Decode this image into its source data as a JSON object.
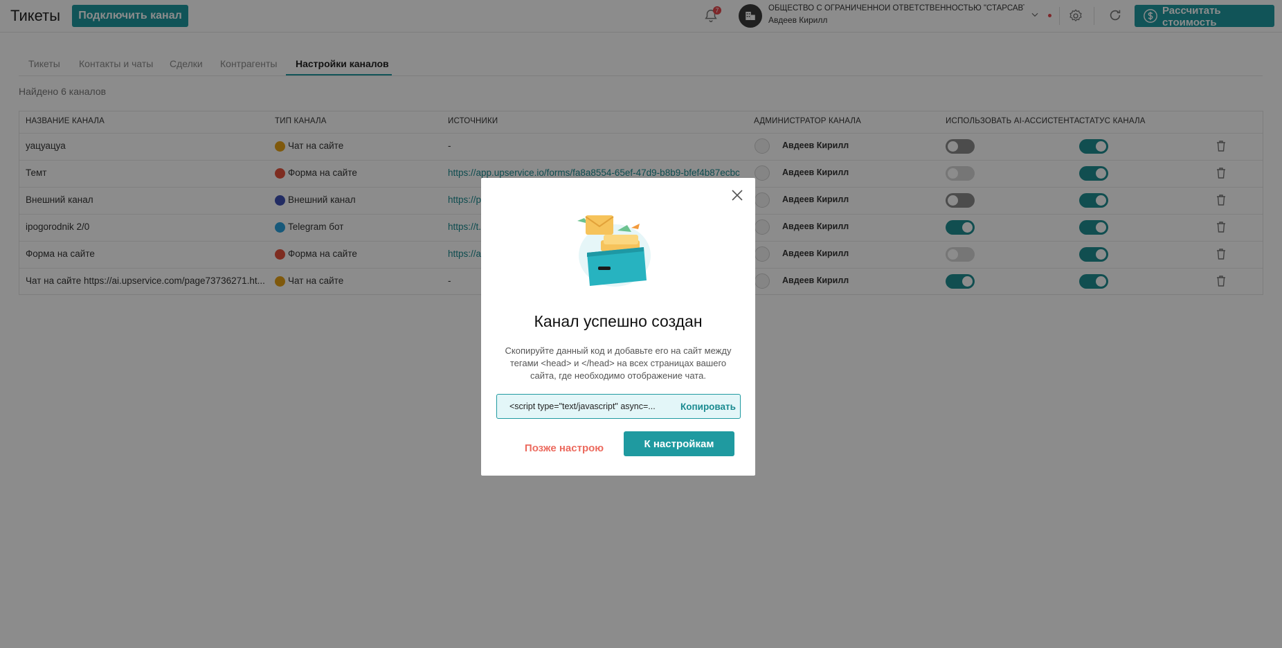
{
  "header": {
    "title": "Тикеты",
    "connect_label": "Подключить канал",
    "notifications_count": "7",
    "org_name": "ОБЩЕСТВО С ОГРАНИЧЕННОЙ ОТВЕТСТВЕННОСТЬЮ \"СТАРСАВТО\"...",
    "user_name": "Авдеев Кирилл",
    "calc_label": "Рассчитать стоимость"
  },
  "tabs": [
    {
      "label": "Тикеты"
    },
    {
      "label": "Контакты и чаты"
    },
    {
      "label": "Сделки"
    },
    {
      "label": "Контрагенты"
    },
    {
      "label": "Настройки каналов",
      "active": true
    }
  ],
  "found_text": "Найдено 6 каналов",
  "table": {
    "columns": [
      "НАЗВАНИЕ КАНАЛА",
      "ТИП КАНАЛА",
      "ИСТОЧНИКИ",
      "АДМИНИСТРАТОР КАНАЛА",
      "ИСПОЛЬЗОВАТЬ AI-АССИСТЕНТА",
      "СТАТУС КАНАЛА"
    ],
    "rows": [
      {
        "name": "уацуацуа",
        "type": "Чат на сайте",
        "type_color": "#e8a317",
        "source": "-",
        "admin": "Авдеев Кирилл",
        "ai": "off",
        "status": "on"
      },
      {
        "name": "Темт",
        "type": "Форма на сайте",
        "type_color": "#e5533d",
        "source": "https://app.upservice.io/forms/fa8a8554-65ef-47d9-b8b9-bfef4b87ecbc",
        "admin": "Авдеев Кирилл",
        "ai": "disabled",
        "status": "on"
      },
      {
        "name": "Внешний канал",
        "type": "Внешний канал",
        "type_color": "#3f51b5",
        "source": "https://p",
        "admin": "Авдеев Кирилл",
        "ai": "off",
        "status": "on"
      },
      {
        "name": "ipogorodnik 2/0",
        "type": "Telegram бот",
        "type_color": "#2aa3df",
        "source": "https://t.",
        "admin": "Авдеев Кирилл",
        "ai": "on",
        "status": "on"
      },
      {
        "name": "Форма на сайте",
        "type": "Форма на сайте",
        "type_color": "#e5533d",
        "source": "https://a",
        "admin": "Авдеев Кирилл",
        "ai": "disabled",
        "status": "on"
      },
      {
        "name": "Чат на сайте https://ai.upservice.com/page73736271.ht...",
        "type": "Чат на сайте",
        "type_color": "#e8a317",
        "source": "-",
        "admin": "Авдеев Кирилл",
        "ai": "on",
        "status": "on"
      }
    ]
  },
  "modal": {
    "title": "Канал успешно создан",
    "description": "Скопируйте данный код и добавьте его на сайт между тегами <head> и </head> на всех страницах вашего сайта, где необходимо отображение чата.",
    "code": "<script type=\"text/javascript\" async=...",
    "copy_label": "Копировать",
    "later_label": "Позже настрою",
    "settings_label": "К настройкам"
  },
  "colors": {
    "accent": "#1f9aa0",
    "danger": "#ec6a5e"
  }
}
